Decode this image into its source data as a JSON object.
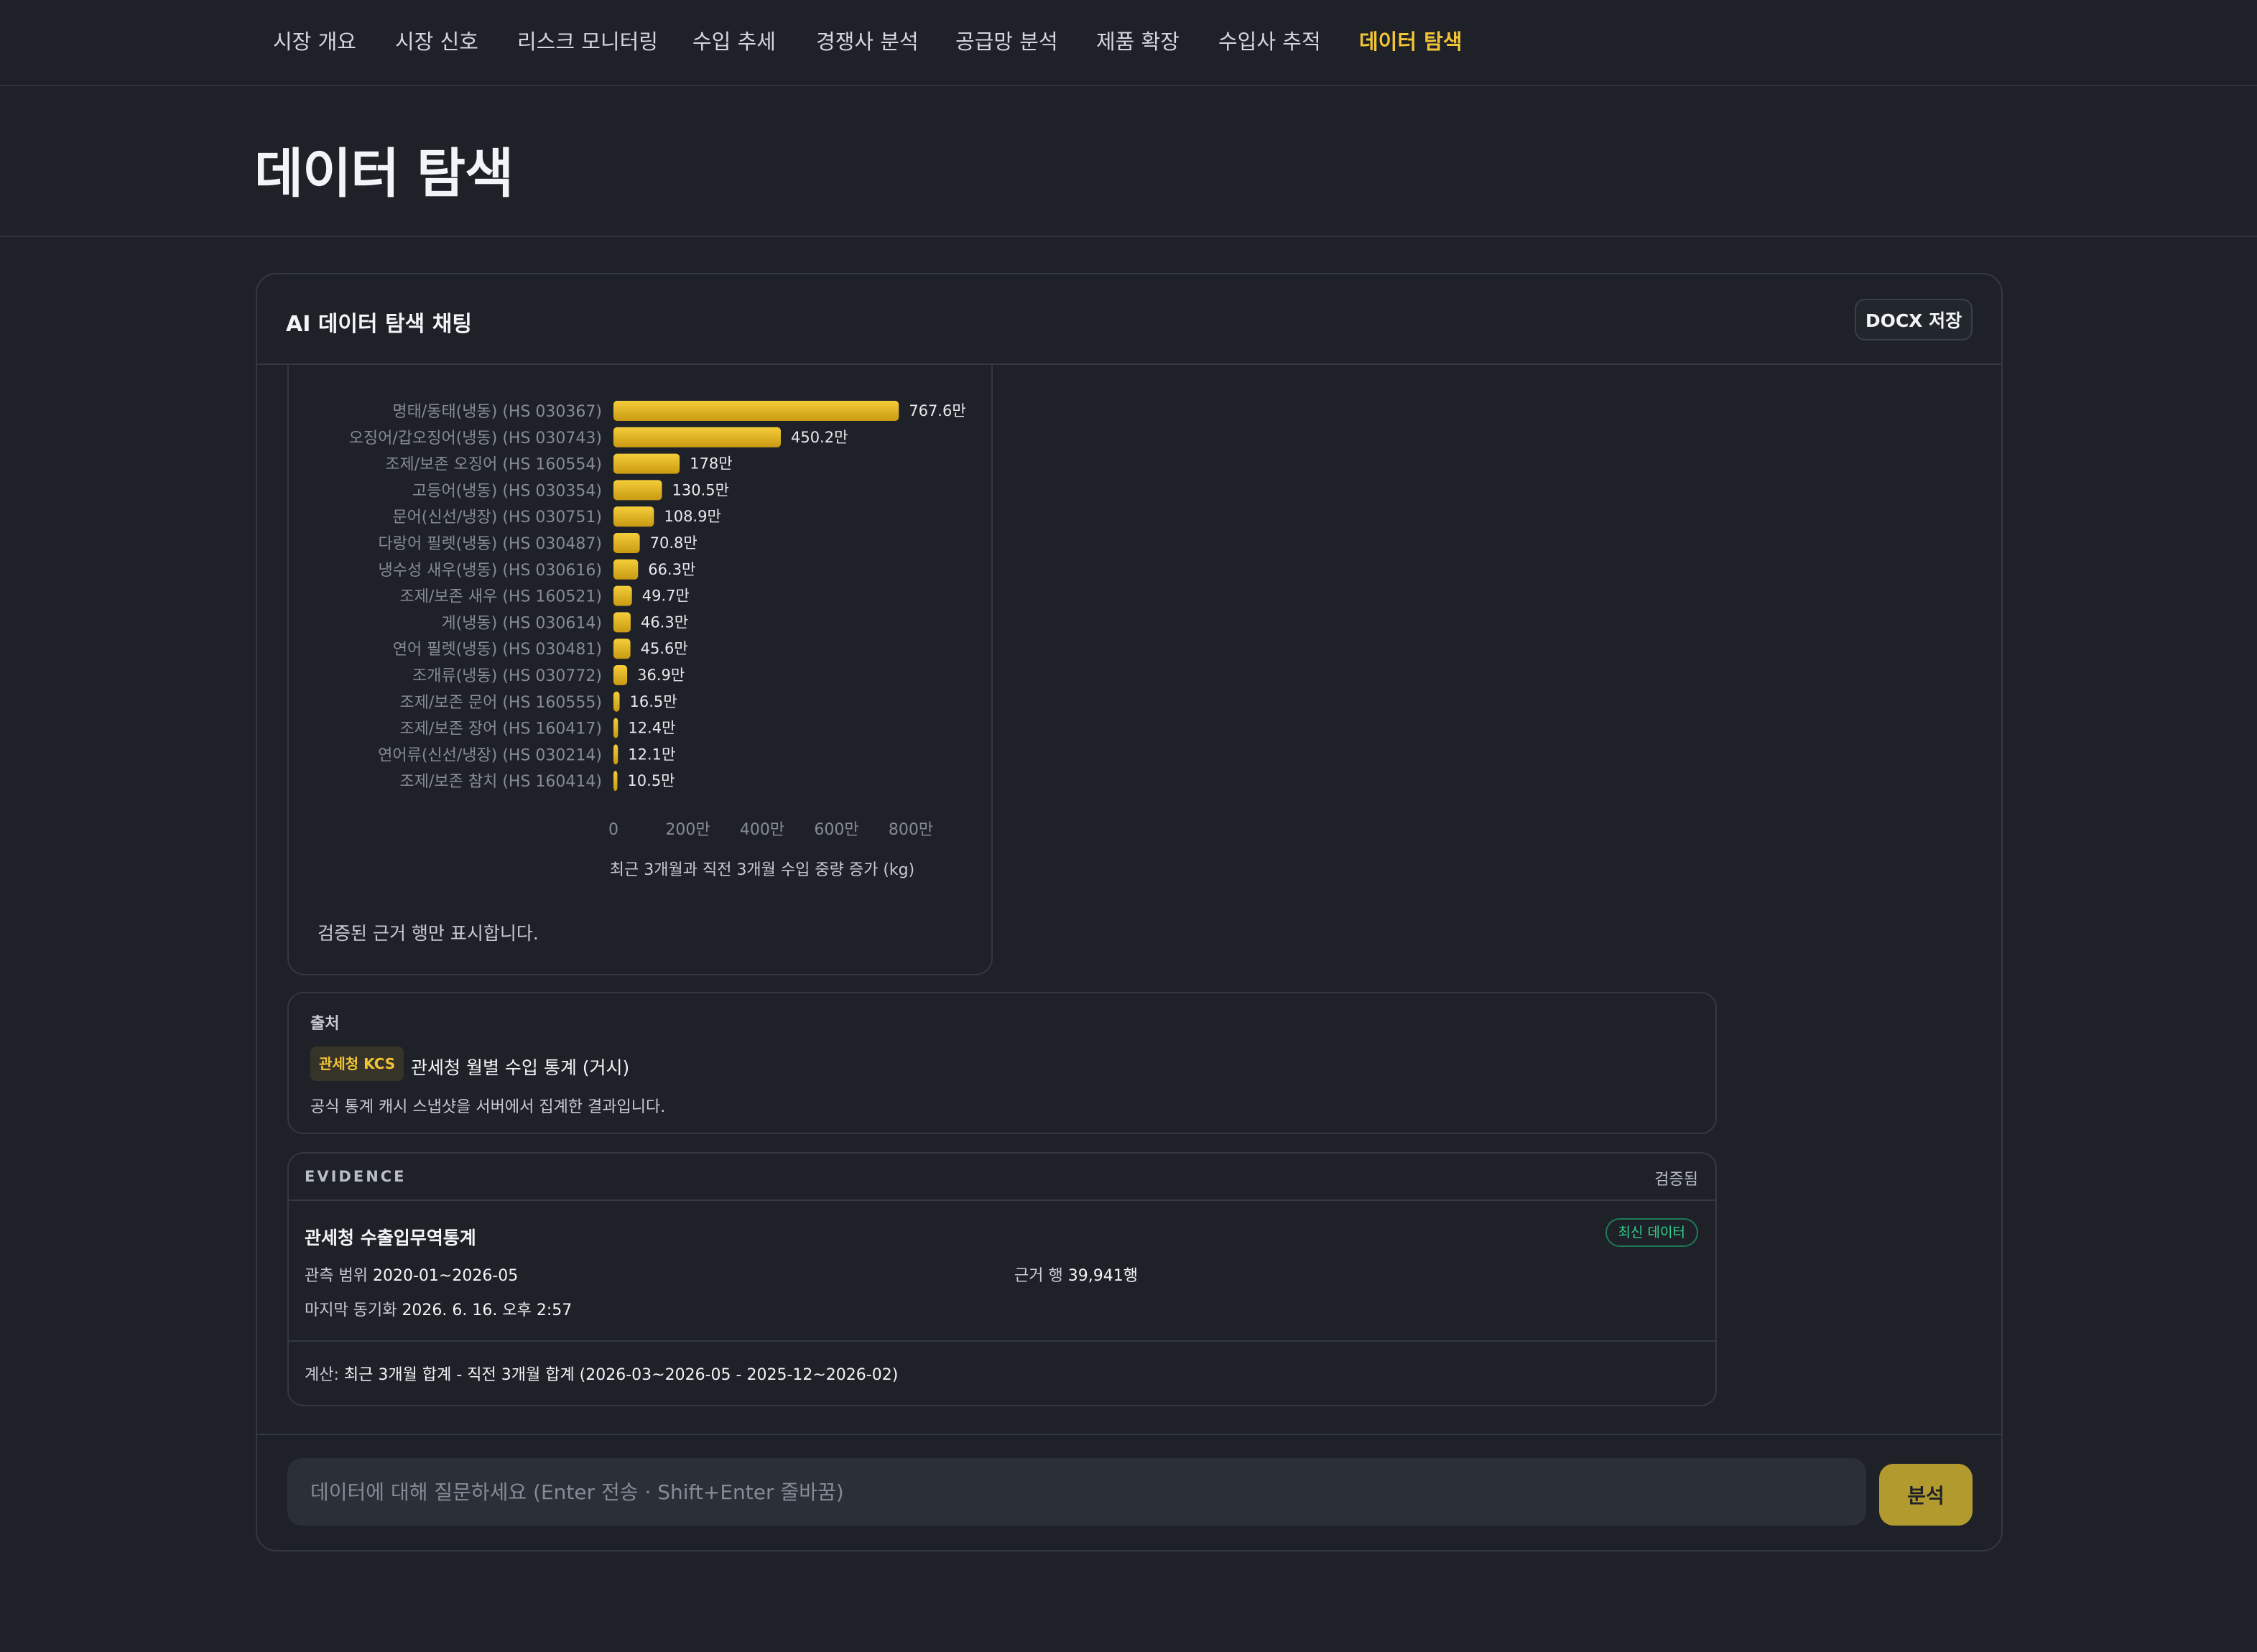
{
  "nav": {
    "tabs": [
      {
        "label": "시장 개요"
      },
      {
        "label": "시장 신호"
      },
      {
        "label": "리스크 모니터링"
      },
      {
        "label": "수입 추세"
      },
      {
        "label": "경쟁사 분석"
      },
      {
        "label": "공급망 분석"
      },
      {
        "label": "제품 확장"
      },
      {
        "label": "수입사 추적"
      },
      {
        "label": "데이터 탐색"
      }
    ],
    "active_index": 8,
    "active_color": "#f2c536"
  },
  "page": {
    "title": "데이터 탐색"
  },
  "panel": {
    "title": "AI 데이터 탐색 채팅",
    "docx_label": "DOCX 저장"
  },
  "chart_note": "검증된 근거 행만 표시합니다.",
  "chart_data": {
    "type": "bar",
    "orientation": "horizontal",
    "categories": [
      "명태/동태(냉동) (HS 030367)",
      "오징어/갑오징어(냉동) (HS 030743)",
      "조제/보존 오징어 (HS 160554)",
      "고등어(냉동) (HS 030354)",
      "문어(신선/냉장) (HS 030751)",
      "다랑어 필렛(냉동) (HS 030487)",
      "냉수성 새우(냉동) (HS 030616)",
      "조제/보존 새우 (HS 160521)",
      "게(냉동) (HS 030614)",
      "연어 필렛(냉동) (HS 030481)",
      "조개류(냉동) (HS 030772)",
      "조제/보존 문어 (HS 160555)",
      "조제/보존 장어 (HS 160417)",
      "연어류(신선/냉장) (HS 030214)",
      "조제/보존 참치 (HS 160414)"
    ],
    "values": [
      7676000,
      4502000,
      1780000,
      1305000,
      1089000,
      708000,
      663000,
      497000,
      463000,
      456000,
      369000,
      165000,
      124000,
      121000,
      105000
    ],
    "value_labels": [
      "767.6만",
      "450.2만",
      "178만",
      "130.5만",
      "108.9만",
      "70.8만",
      "66.3만",
      "49.7만",
      "46.3만",
      "45.6만",
      "36.9만",
      "16.5만",
      "12.4만",
      "12.1만",
      "10.5만"
    ],
    "xticks": [
      "0",
      "200만",
      "400만",
      "600만",
      "800만"
    ],
    "xlim": [
      0,
      8000000
    ],
    "xlabel": "최근 3개월과 직전 3개월 수입 중량 증가 (kg)",
    "ylabel": "",
    "grid": false,
    "bar_color_top": "#f5cd3a",
    "bar_color_bottom": "#c99a12"
  },
  "source": {
    "label": "출처",
    "badge": "관세청 KCS",
    "name": "관세청 월별 수입 통계 (거시)",
    "desc": "공식 통계 캐시 스냅샷을 서버에서 집계한 결과입니다."
  },
  "evidence": {
    "label": "EVIDENCE",
    "status": "검증됨",
    "title": "관세청 수출입무역통계",
    "badge": "최신 데이터",
    "range_label": "관측 범위",
    "range_value": "2020-01~2026-05",
    "rows_label": "근거 행",
    "rows_value": "39,941행",
    "sync_label": "마지막 동기화",
    "sync_value": "2026. 6. 16. 오후 2:57",
    "calc_label": "계산:",
    "calc_value": "최근 3개월 합계 - 직전 3개월 합계 (2026-03~2026-05 - 2025-12~2026-02)"
  },
  "composer": {
    "placeholder": "데이터에 대해 질문하세요 (Enter 전송 · Shift+Enter 줄바꿈)",
    "value": "",
    "submit_label": "분석"
  }
}
